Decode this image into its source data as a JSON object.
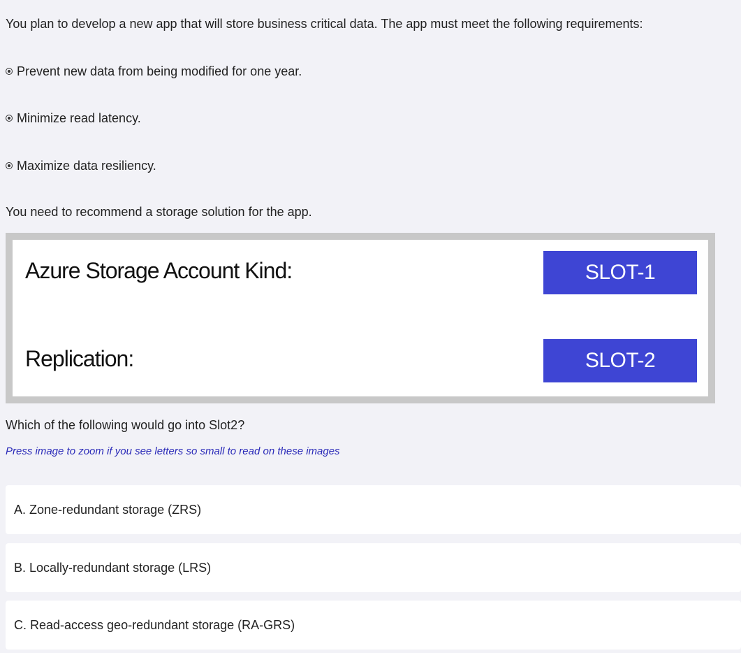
{
  "question": {
    "intro": "You plan to develop a new app that will store business critical data. The app must meet the following requirements:",
    "requirements": [
      "Prevent new data from being modified for one year.",
      "Minimize read latency.",
      "Maximize data resiliency."
    ],
    "recommend": "You need to recommend a storage solution for the app.",
    "prompt": "Which of the following would go into Slot2?",
    "hint": "Press image to zoom if you see letters so small to read on these images"
  },
  "exhibit": {
    "label_1": "Azure Storage Account Kind:",
    "slot_1": "SLOT-1",
    "label_2": "Replication:",
    "slot_2": "SLOT-2",
    "frame_color": "#c8c8c8",
    "slot_color": "#3e45d4"
  },
  "options": [
    {
      "text": "A. Zone-redundant storage (ZRS)"
    },
    {
      "text": "B. Locally-redundant storage (LRS)"
    },
    {
      "text": "C. Read-access geo-redundant storage (RA-GRS)"
    }
  ]
}
